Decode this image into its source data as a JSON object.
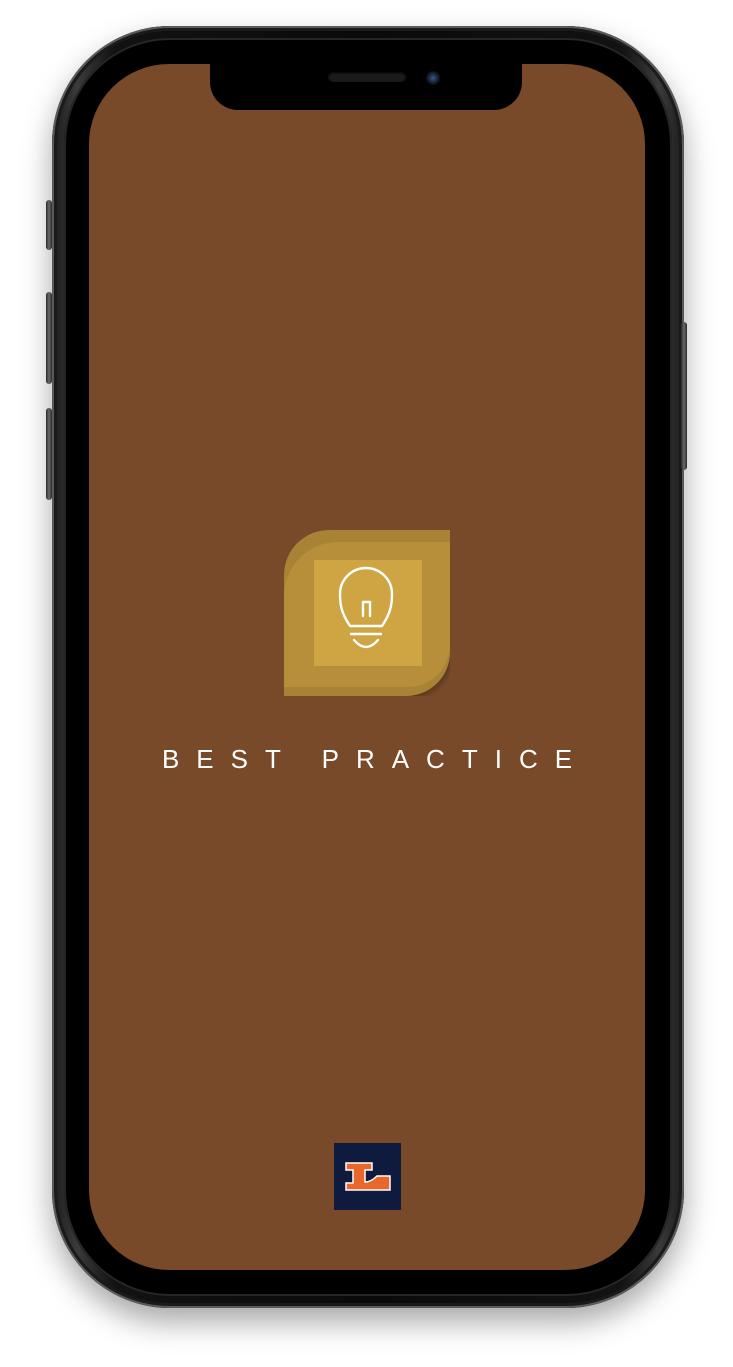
{
  "app": {
    "title": "BEST PRACTICE"
  },
  "icons": {
    "app_icon": "lightbulb-icon",
    "brand_logo": "brand-logo-l"
  },
  "colors": {
    "screen_background": "#784a29",
    "icon_gold_light": "#cfa544",
    "icon_gold_dark": "#a88235",
    "brand_background": "#0e1a3e",
    "brand_accent": "#e8672a",
    "title_color": "#ffffff"
  }
}
